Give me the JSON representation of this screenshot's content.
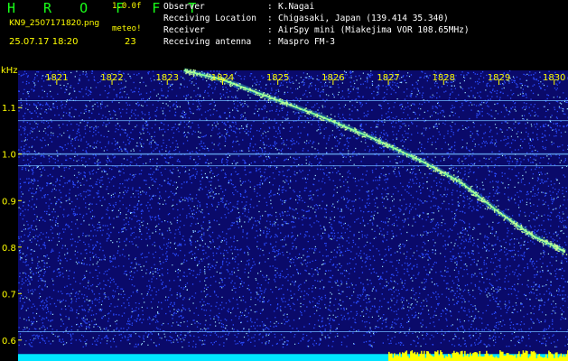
{
  "header": {
    "logo": "H R O F F T",
    "version": "1.0.0f",
    "filename": "KN9_2507171820.png",
    "meteo_label": "meteo!",
    "datetime": "25.07.17 18:20",
    "count": "23",
    "info": [
      {
        "label": "Observer",
        "value": "K.Nagai"
      },
      {
        "label": "Receiving Location",
        "value": "Chigasaki, Japan (139.414 35.340)"
      },
      {
        "label": "Receiver",
        "value": "AirSpy mini (Miakejima VOR 108.65MHz)"
      },
      {
        "label": "Receiving antenna",
        "value": "Maspro FM-3"
      }
    ]
  },
  "colors": {
    "background": "#0a0a6a",
    "noise_dim": "#2a4cff",
    "noise_bright": "#9fe8ff",
    "trace": "#7cff9a",
    "baseline": "#00e5ff",
    "activity": "#ffff00",
    "tick_label": "#ffff00",
    "header_text": "#ffffff",
    "logo": "#19ff19"
  },
  "chart_data": {
    "type": "heatmap",
    "ylabel": "kHz",
    "x_ticks": [
      "1821",
      "1822",
      "1823",
      "1824",
      "1825",
      "1826",
      "1827",
      "1828",
      "1829",
      "1830"
    ],
    "x_range": [
      1820.3,
      1830.25
    ],
    "y_ticks": [
      "0.6",
      "0.7",
      "0.8",
      "0.9",
      "1.0",
      "1.1"
    ],
    "y_range": [
      0.555,
      1.18
    ],
    "meteor_trace": [
      {
        "x": 1823.3,
        "y": 1.18
      },
      {
        "x": 1824.0,
        "y": 1.16
      },
      {
        "x": 1824.9,
        "y": 1.12
      },
      {
        "x": 1825.8,
        "y": 1.08
      },
      {
        "x": 1826.7,
        "y": 1.035
      },
      {
        "x": 1827.6,
        "y": 0.985
      },
      {
        "x": 1828.3,
        "y": 0.94
      },
      {
        "x": 1829.0,
        "y": 0.875
      },
      {
        "x": 1829.6,
        "y": 0.825
      },
      {
        "x": 1830.2,
        "y": 0.79
      }
    ],
    "carrier_lines_khz": [
      1.115,
      1.072,
      1.0,
      0.975,
      0.618
    ],
    "baseline_band_khz": [
      0.555,
      0.57
    ],
    "activity_band_x": [
      1827.0,
      1830.25
    ]
  }
}
